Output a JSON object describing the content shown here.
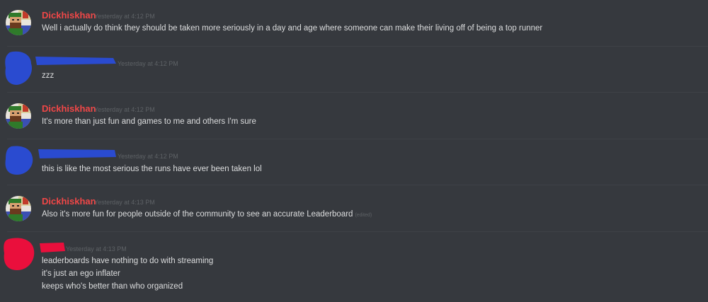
{
  "chat": {
    "messages": [
      {
        "author": "Dickhiskhan",
        "timestamp": "Yesterday at 4:12 PM",
        "lines": [
          "Well i actually do think they should be taken more seriously in a day and age where someone can make their living off of being a top runner"
        ]
      },
      {
        "author": "",
        "author_redacted": true,
        "redact_color": "#2a4bd0",
        "timestamp": "Yesterday at 4:12 PM",
        "lines": [
          "zzz"
        ]
      },
      {
        "author": "Dickhiskhan",
        "timestamp": "Yesterday at 4:12 PM",
        "lines": [
          "It's more than just fun and games to me and others I'm sure"
        ]
      },
      {
        "author": "",
        "author_redacted": true,
        "redact_color": "#2a4bd0",
        "timestamp": "Yesterday at 4:12 PM",
        "lines": [
          "this is like the most serious the runs have ever been taken lol"
        ]
      },
      {
        "author": "Dickhiskhan",
        "timestamp": "Yesterday at 4:13 PM",
        "lines": [
          "Also it's more fun for people outside of the community to see an accurate Leaderboard"
        ],
        "edited_label": "(edited)"
      },
      {
        "author": "",
        "author_redacted": true,
        "redact_color": "#ea0f3c",
        "timestamp": "Yesterday at 4:13 PM",
        "lines": [
          "leaderboards have nothing to do with streaming",
          "it's just an ego inflater",
          "keeps who's better than who organized"
        ]
      }
    ]
  },
  "colors": {
    "background": "#36393e",
    "divider": "#3e4147",
    "author_name": "#f04747",
    "message_text": "#dcddde",
    "timestamp": "#5e6266"
  },
  "icons": {
    "avatar": "pixel-character-avatar-icon"
  }
}
